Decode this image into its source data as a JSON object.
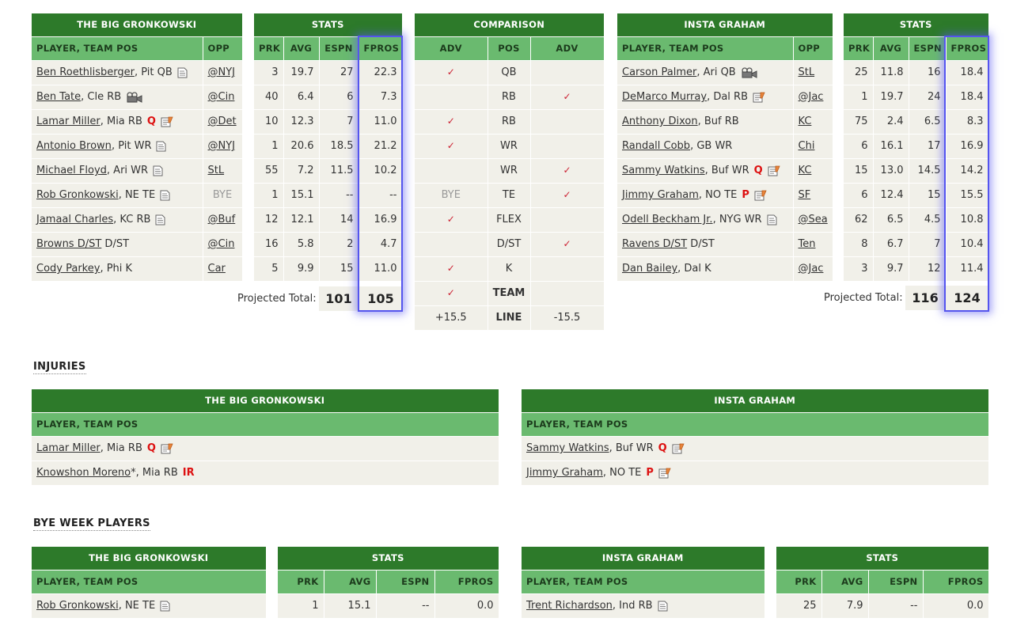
{
  "left_team": "THE BIG GRONKOWSKI",
  "right_team": "INSTA GRAHAM",
  "headers": {
    "stats": "STATS",
    "comparison": "COMPARISON",
    "player_team_pos": "PLAYER, TEAM POS",
    "opp": "OPP",
    "prk": "PRK",
    "avg": "AVG",
    "espn": "ESPN",
    "fpros": "FPROS",
    "adv": "ADV",
    "pos": "POS"
  },
  "left_roster": [
    {
      "name": "Ben Roethlisberger",
      "team_pos": ", Pit QB",
      "icon": "notes-icon",
      "status": "",
      "opp": "@NYJ",
      "prk": "3",
      "avg": "19.7",
      "espn": "27",
      "fpros": "22.3"
    },
    {
      "name": "Ben Tate",
      "team_pos": ", Cle RB",
      "icon": "video-icon",
      "status": "",
      "opp": "@Cin",
      "prk": "40",
      "avg": "6.4",
      "espn": "6",
      "fpros": "7.3"
    },
    {
      "name": "Lamar Miller",
      "team_pos": ", Mia RB",
      "icon": "news-icon",
      "status": "Q",
      "opp": "@Det",
      "prk": "10",
      "avg": "12.3",
      "espn": "7",
      "fpros": "11.0"
    },
    {
      "name": "Antonio Brown",
      "team_pos": ", Pit WR",
      "icon": "notes-icon",
      "status": "",
      "opp": "@NYJ",
      "prk": "1",
      "avg": "20.6",
      "espn": "18.5",
      "fpros": "21.2"
    },
    {
      "name": "Michael Floyd",
      "team_pos": ", Ari WR",
      "icon": "notes-icon",
      "status": "",
      "opp": "StL",
      "prk": "55",
      "avg": "7.2",
      "espn": "11.5",
      "fpros": "10.2"
    },
    {
      "name": "Rob Gronkowski",
      "team_pos": ", NE TE",
      "icon": "notes-icon",
      "status": "",
      "opp": "BYE",
      "prk": "1",
      "avg": "15.1",
      "espn": "--",
      "fpros": "--"
    },
    {
      "name": "Jamaal Charles",
      "team_pos": ", KC RB",
      "icon": "notes-icon",
      "status": "",
      "opp": "@Buf",
      "prk": "12",
      "avg": "12.1",
      "espn": "14",
      "fpros": "16.9"
    },
    {
      "name": "Browns D/ST",
      "team_pos": " D/ST",
      "icon": "",
      "status": "",
      "opp": "@Cin",
      "prk": "16",
      "avg": "5.8",
      "espn": "2",
      "fpros": "4.7"
    },
    {
      "name": "Cody Parkey",
      "team_pos": ", Phi K",
      "icon": "",
      "status": "",
      "opp": "Car",
      "prk": "5",
      "avg": "9.9",
      "espn": "15",
      "fpros": "11.0"
    }
  ],
  "right_roster": [
    {
      "name": "Carson Palmer",
      "team_pos": ", Ari QB",
      "icon": "video-icon",
      "status": "",
      "opp": "StL",
      "prk": "25",
      "avg": "11.8",
      "espn": "16",
      "fpros": "18.4"
    },
    {
      "name": "DeMarco Murray",
      "team_pos": ", Dal RB",
      "icon": "news-icon",
      "status": "",
      "opp": "@Jac",
      "prk": "1",
      "avg": "19.7",
      "espn": "24",
      "fpros": "18.4"
    },
    {
      "name": "Anthony Dixon",
      "team_pos": ", Buf RB",
      "icon": "",
      "status": "",
      "opp": "KC",
      "prk": "75",
      "avg": "2.4",
      "espn": "6.5",
      "fpros": "8.3"
    },
    {
      "name": "Randall Cobb",
      "team_pos": ", GB WR",
      "icon": "",
      "status": "",
      "opp": "Chi",
      "prk": "6",
      "avg": "16.1",
      "espn": "17",
      "fpros": "16.9"
    },
    {
      "name": "Sammy Watkins",
      "team_pos": ", Buf WR",
      "icon": "news-icon",
      "status": "Q",
      "opp": "KC",
      "prk": "15",
      "avg": "13.0",
      "espn": "14.5",
      "fpros": "14.2"
    },
    {
      "name": "Jimmy Graham",
      "team_pos": ", NO TE",
      "icon": "news-icon",
      "status": "P",
      "opp": "SF",
      "prk": "6",
      "avg": "12.4",
      "espn": "15",
      "fpros": "15.5"
    },
    {
      "name": "Odell Beckham Jr.",
      "team_pos": ", NYG WR",
      "icon": "notes-icon",
      "status": "",
      "opp": "@Sea",
      "prk": "62",
      "avg": "6.5",
      "espn": "4.5",
      "fpros": "10.8"
    },
    {
      "name": "Ravens D/ST",
      "team_pos": " D/ST",
      "icon": "",
      "status": "",
      "opp": "Ten",
      "prk": "8",
      "avg": "6.7",
      "espn": "7",
      "fpros": "10.4"
    },
    {
      "name": "Dan Bailey",
      "team_pos": ", Dal K",
      "icon": "",
      "status": "",
      "opp": "@Jac",
      "prk": "3",
      "avg": "9.7",
      "espn": "12",
      "fpros": "11.4"
    }
  ],
  "comparison": [
    {
      "left": "✓",
      "pos": "QB",
      "right": ""
    },
    {
      "left": "",
      "pos": "RB",
      "right": "✓"
    },
    {
      "left": "✓",
      "pos": "RB",
      "right": ""
    },
    {
      "left": "✓",
      "pos": "WR",
      "right": ""
    },
    {
      "left": "",
      "pos": "WR",
      "right": "✓"
    },
    {
      "left": "BYE",
      "pos": "TE",
      "right": "✓"
    },
    {
      "left": "✓",
      "pos": "FLEX",
      "right": ""
    },
    {
      "left": "",
      "pos": "D/ST",
      "right": "✓"
    },
    {
      "left": "✓",
      "pos": "K",
      "right": ""
    },
    {
      "left": "✓",
      "pos": "TEAM",
      "right": ""
    },
    {
      "left": "+15.5",
      "pos": "LINE",
      "right": "-15.5"
    }
  ],
  "left_totals": {
    "label": "Projected Total:",
    "espn": "101",
    "fpros": "105"
  },
  "right_totals": {
    "label": "Projected Total:",
    "espn": "116",
    "fpros": "124"
  },
  "injuries": {
    "title": "INJURIES",
    "left": [
      {
        "name": "Lamar Miller",
        "team_pos": ", Mia RB",
        "status": "Q",
        "icon": "news-icon",
        "suffix": ""
      },
      {
        "name": "Knowshon Moreno",
        "team_pos": ", Mia RB",
        "status": "IR",
        "icon": "",
        "suffix": "*"
      }
    ],
    "right": [
      {
        "name": "Sammy Watkins",
        "team_pos": ", Buf WR",
        "status": "Q",
        "icon": "news-icon",
        "suffix": ""
      },
      {
        "name": "Jimmy Graham",
        "team_pos": ", NO TE",
        "status": "P",
        "icon": "news-icon",
        "suffix": ""
      }
    ]
  },
  "bye_week": {
    "title": "BYE WEEK PLAYERS",
    "left": {
      "name": "Rob Gronkowski",
      "team_pos": ", NE TE",
      "icon": "notes-icon",
      "prk": "1",
      "avg": "15.1",
      "espn": "--",
      "fpros": "0.0"
    },
    "right": {
      "name": "Trent Richardson",
      "team_pos": ", Ind RB",
      "icon": "notes-icon",
      "prk": "25",
      "avg": "7.9",
      "espn": "--",
      "fpros": "0.0"
    }
  },
  "colors": {
    "header_dark": "#2d7a2a",
    "header_light": "#6aba6f",
    "row_bg": "#f1f0e9",
    "check": "#cc2233",
    "status_red": "#dd1111",
    "highlight": "#5555ee"
  }
}
